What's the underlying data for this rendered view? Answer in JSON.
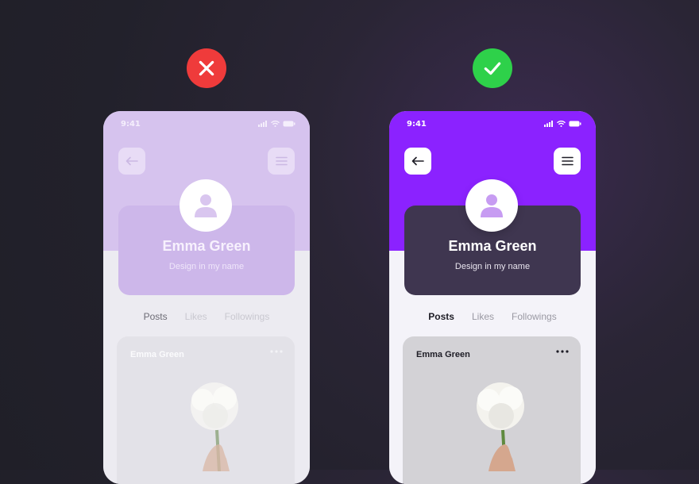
{
  "indicators": {
    "bad": {
      "icon": "x-icon",
      "color": "#ef3b3b"
    },
    "good": {
      "icon": "check-icon",
      "color": "#2ed14a"
    }
  },
  "phones": [
    {
      "variant": "bad",
      "status_time": "9:41",
      "profile_name": "Emma Green",
      "profile_tagline": "Design in my name",
      "tabs": [
        "Posts",
        "Likes",
        "Followings"
      ],
      "active_tab": "Posts",
      "post": {
        "author": "Emma Green"
      },
      "colors": {
        "header": "#d6c3ee",
        "card": "#cdb7ea"
      }
    },
    {
      "variant": "good",
      "status_time": "9:41",
      "profile_name": "Emma Green",
      "profile_tagline": "Design in my name",
      "tabs": [
        "Posts",
        "Likes",
        "Followings"
      ],
      "active_tab": "Posts",
      "post": {
        "author": "Emma Green"
      },
      "colors": {
        "header": "#8b22ff",
        "card": "#3f3650"
      }
    }
  ]
}
